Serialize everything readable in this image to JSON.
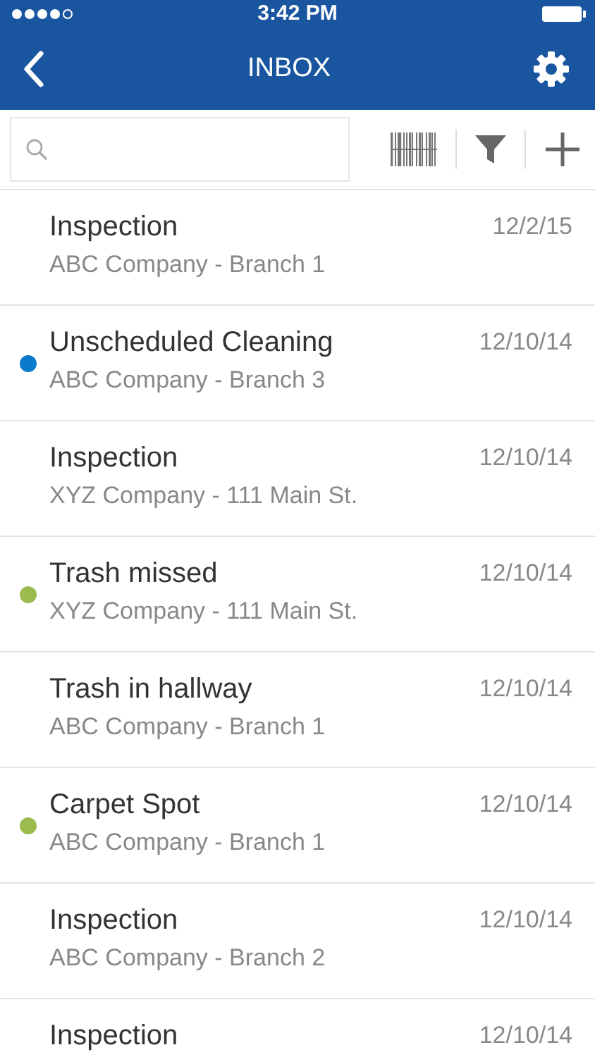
{
  "status_bar": {
    "time": "3:42 PM"
  },
  "nav_bar": {
    "title": "INBOX"
  },
  "messages": [
    {
      "title": "Inspection",
      "subtitle": "ABC Company - Branch 1",
      "date": "12/2/15"
    },
    {
      "title": "Unscheduled Cleaning",
      "subtitle": "ABC Company - Branch 3",
      "date": "12/10/14",
      "color": "#0a7acc"
    },
    {
      "title": "Inspection",
      "subtitle": "XYZ Company - 111 Main St.",
      "date": "12/10/14"
    },
    {
      "title": "Trash missed",
      "subtitle": "XYZ Company - 111 Main St.",
      "date": "12/10/14",
      "color": "#9bbb4f"
    },
    {
      "title": "Trash in hallway",
      "subtitle": "ABC Company - Branch 1",
      "date": "12/10/14"
    },
    {
      "title": "Carpet Spot",
      "subtitle": "ABC Company - Branch 1",
      "date": "12/10/14",
      "color": "#9bbb4f"
    },
    {
      "title": "Inspection",
      "subtitle": "ABC Company - Branch 2",
      "date": "12/10/14"
    },
    {
      "title": "Inspection",
      "date": "12/10/14"
    }
  ]
}
